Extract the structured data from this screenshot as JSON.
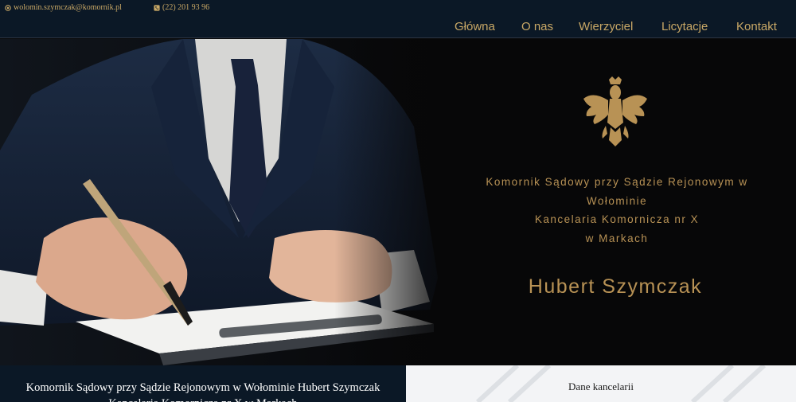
{
  "topbar": {
    "email": "wolomin.szymczak@komornik.pl",
    "phone": "(22) 201 93 96",
    "email_icon": "email-icon",
    "phone_icon": "phone-icon"
  },
  "nav": {
    "items": [
      {
        "label": "Główna"
      },
      {
        "label": "O nas"
      },
      {
        "label": "Wierzyciel"
      },
      {
        "label": "Licytacje"
      },
      {
        "label": "Kontakt"
      }
    ]
  },
  "hero": {
    "line1": "Komornik Sądowy przy Sądzie Rejonowym w",
    "line2": "Wołominie",
    "line3": "Kancelaria Komornicza nr X",
    "line4": "w Markach",
    "name": "Hubert Szymczak",
    "emblem": "polish-eagle-emblem"
  },
  "footer": {
    "left_line1": "Komornik Sądowy przy Sądzie Rejonowym w Wołominie Hubert Szymczak",
    "left_line2": "Kancelaria Komornicza nr X w Markach",
    "right_title": "Dane kancelarii"
  },
  "colors": {
    "gold": "#b89255",
    "navy": "#0b1826",
    "background": "#070708"
  }
}
